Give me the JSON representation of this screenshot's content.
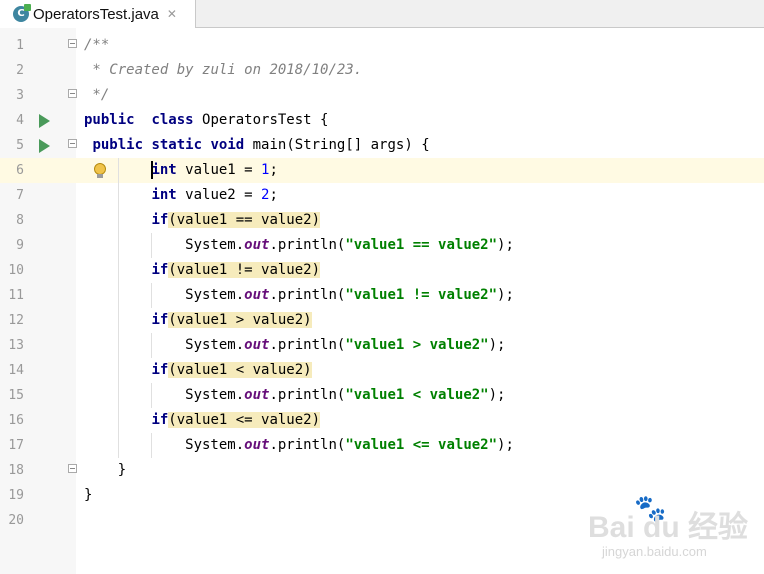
{
  "tab": {
    "icon_letter": "C",
    "title": "OperatorsTest.java",
    "close_glyph": "✕"
  },
  "editor": {
    "current_line": 6,
    "line_numbers": [
      "1",
      "2",
      "3",
      "4",
      "5",
      "6",
      "7",
      "8",
      "9",
      "10",
      "11",
      "12",
      "13",
      "14",
      "15",
      "16",
      "17",
      "18",
      "19",
      "20"
    ],
    "lines": [
      [
        [
          "cm",
          "/**"
        ]
      ],
      [
        [
          "cm",
          " * Created by "
        ],
        [
          "cm",
          "zuli"
        ],
        [
          "cm",
          " on 2018/10/23."
        ]
      ],
      [
        [
          "cm",
          " */"
        ]
      ],
      [
        [
          "kw",
          "public"
        ],
        [
          "",
          "  "
        ],
        [
          "kw",
          "class"
        ],
        [
          "",
          " OperatorsTest {"
        ]
      ],
      [
        [
          "",
          " "
        ],
        [
          "kw",
          "public"
        ],
        [
          "",
          " "
        ],
        [
          "kw",
          "static"
        ],
        [
          "",
          " "
        ],
        [
          "kw",
          "void"
        ],
        [
          "",
          " main(String[] args) {"
        ]
      ],
      [
        [
          "",
          "        "
        ],
        [
          "kw",
          "int"
        ],
        [
          "",
          " value1 = "
        ],
        [
          "num",
          "1"
        ],
        [
          "",
          ";"
        ]
      ],
      [
        [
          "",
          "        "
        ],
        [
          "kw",
          "int"
        ],
        [
          "",
          " value2 = "
        ],
        [
          "num",
          "2"
        ],
        [
          "",
          ";"
        ]
      ],
      [
        [
          "",
          "        "
        ],
        [
          "kw",
          "if"
        ],
        [
          "hl",
          "(value1 == value2)"
        ]
      ],
      [
        [
          "",
          "            System."
        ],
        [
          "fld",
          "out"
        ],
        [
          "",
          ".println("
        ],
        [
          "str",
          "\"value1 == value2\""
        ],
        [
          "",
          ");"
        ]
      ],
      [
        [
          "",
          "        "
        ],
        [
          "kw",
          "if"
        ],
        [
          "hl",
          "(value1 != value2)"
        ]
      ],
      [
        [
          "",
          "            System."
        ],
        [
          "fld",
          "out"
        ],
        [
          "",
          ".println("
        ],
        [
          "str",
          "\"value1 != value2\""
        ],
        [
          "",
          ");"
        ]
      ],
      [
        [
          "",
          "        "
        ],
        [
          "kw",
          "if"
        ],
        [
          "hl",
          "(value1 > value2)"
        ]
      ],
      [
        [
          "",
          "            System."
        ],
        [
          "fld",
          "out"
        ],
        [
          "",
          ".println("
        ],
        [
          "str",
          "\"value1 > value2\""
        ],
        [
          "",
          ");"
        ]
      ],
      [
        [
          "",
          "        "
        ],
        [
          "kw",
          "if"
        ],
        [
          "hl",
          "(value1 < value2)"
        ]
      ],
      [
        [
          "",
          "            System."
        ],
        [
          "fld",
          "out"
        ],
        [
          "",
          ".println("
        ],
        [
          "str",
          "\"value1 < value2\""
        ],
        [
          "",
          ");"
        ]
      ],
      [
        [
          "",
          "        "
        ],
        [
          "kw",
          "if"
        ],
        [
          "hl",
          "(value1 <= value2)"
        ]
      ],
      [
        [
          "",
          "            System."
        ],
        [
          "fld",
          "out"
        ],
        [
          "",
          ".println("
        ],
        [
          "str",
          "\"value1 <= value2\""
        ],
        [
          "",
          ");"
        ]
      ],
      [
        [
          "",
          "    }"
        ]
      ],
      [
        [
          "",
          "}"
        ]
      ],
      [
        [
          "",
          ""
        ]
      ]
    ],
    "run_icon_lines": [
      4,
      5
    ],
    "fold_icon_lines": [
      1,
      3,
      5,
      18
    ],
    "intention_bulb_line": 6
  },
  "watermark": {
    "brand": "Bai du 经验",
    "url": "jingyan.baidu.com"
  }
}
